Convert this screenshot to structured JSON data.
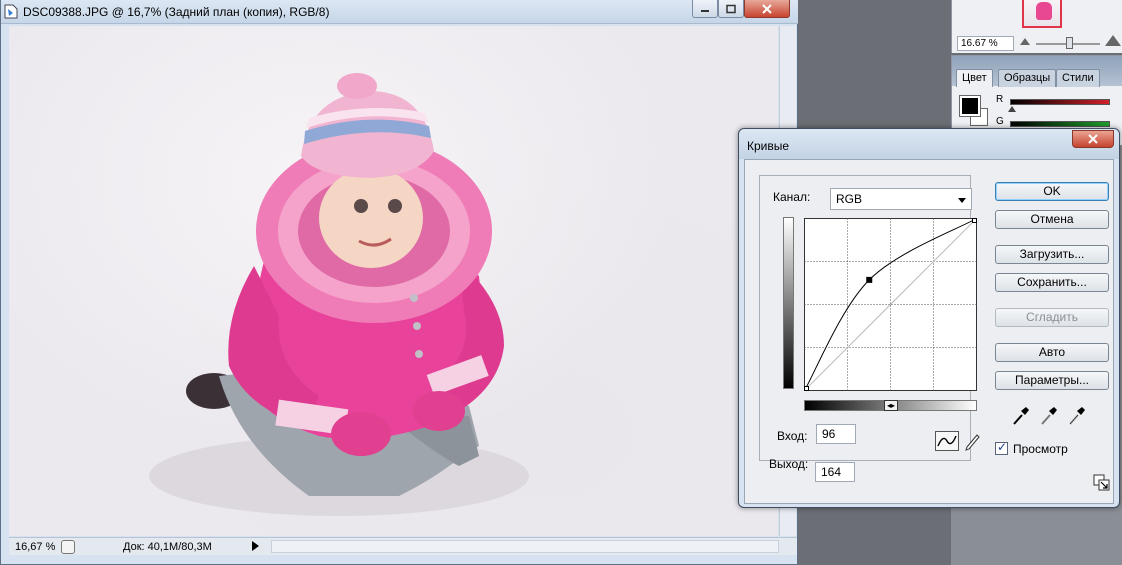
{
  "document": {
    "title": "DSC09388.JPG @ 16,7% (Задний план (копия), RGB/8)",
    "status_zoom": "16,67 %",
    "status_doc": "Док: 40,1M/80,3M"
  },
  "navigator": {
    "zoom": "16.67 %"
  },
  "color_panel": {
    "tabs": [
      "Цвет",
      "Образцы",
      "Стили"
    ],
    "active_tab": "Цвет",
    "channels": [
      "R",
      "G"
    ],
    "foreground_color": "#000000",
    "background_color": "#ffffff"
  },
  "curves": {
    "title": "Кривые",
    "channel_label": "Канал:",
    "channel_value": "RGB",
    "input_label": "Вход:",
    "input_value": "96",
    "output_label": "Выход:",
    "output_value": "164",
    "curve_points": [
      [
        0,
        0
      ],
      [
        96,
        164
      ],
      [
        255,
        255
      ]
    ],
    "buttons": {
      "ok": "OK",
      "cancel": "Отмена",
      "load": "Загрузить...",
      "save": "Сохранить...",
      "smooth": "Сгладить",
      "auto": "Авто",
      "options": "Параметры..."
    },
    "preview_label": "Просмотр",
    "preview_checked": true
  }
}
